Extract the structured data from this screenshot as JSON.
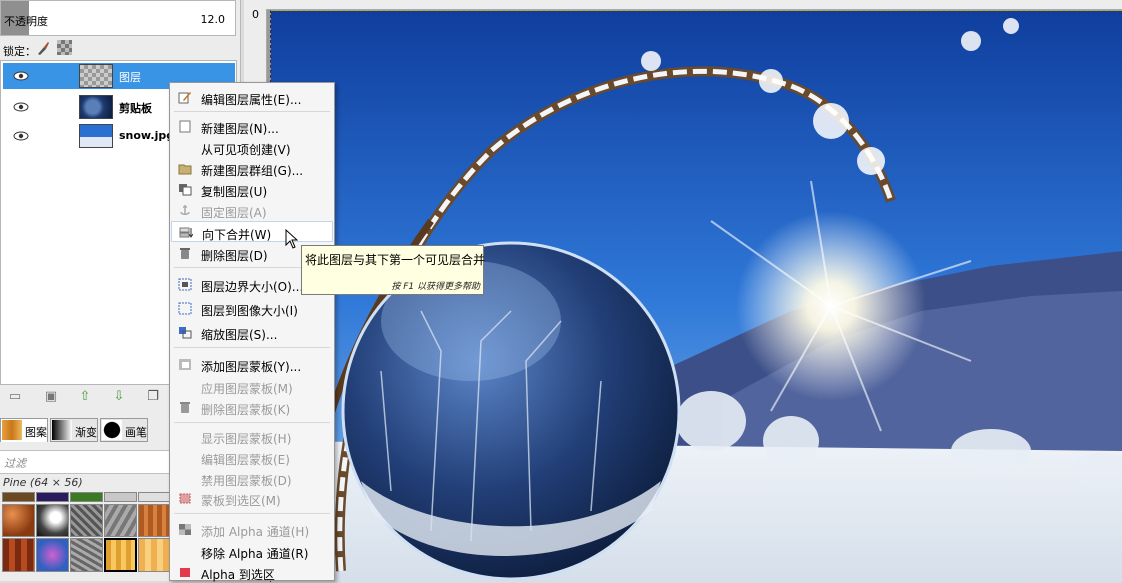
{
  "layers_panel": {
    "opacity_label": "不透明度",
    "opacity_value": "12.0",
    "lock_label": "锁定：",
    "layers": [
      {
        "name": "图层",
        "selected": true
      },
      {
        "name": "剪贴板",
        "selected": false
      },
      {
        "name": "snow.jpg",
        "selected": false
      }
    ]
  },
  "dock_tabs": [
    {
      "label": "图案",
      "active": true,
      "icon": "pattern-icon"
    },
    {
      "label": "渐变",
      "active": false,
      "icon": "gradient-icon"
    },
    {
      "label": "画笔",
      "active": false,
      "icon": "brush-icon"
    }
  ],
  "patterns_panel": {
    "filter_placeholder": "过滤",
    "selected_pattern": "Pine (64 × 56)"
  },
  "ruler": {
    "v_label": "0"
  },
  "context_menu": {
    "items": [
      {
        "label": "编辑图层属性(E)...",
        "icon": "edit-icon",
        "enabled": true
      },
      {
        "label": "新建图层(N)...",
        "icon": "new-layer-icon",
        "enabled": true
      },
      {
        "label": "从可见项创建(V)",
        "icon": "",
        "enabled": true
      },
      {
        "label": "新建图层群组(G)...",
        "icon": "folder-icon",
        "enabled": true
      },
      {
        "label": "复制图层(U)",
        "icon": "duplicate-icon",
        "enabled": true
      },
      {
        "label": "固定图层(A)",
        "icon": "anchor-icon",
        "enabled": false
      },
      {
        "label": "向下合并(W)",
        "icon": "merge-down-icon",
        "enabled": true,
        "highlighted": true
      },
      {
        "label": "删除图层(D)",
        "icon": "delete-icon",
        "enabled": true
      },
      {
        "label": "图层边界大小(O)...",
        "icon": "boundary-icon",
        "enabled": true
      },
      {
        "label": "图层到图像大小(I)",
        "icon": "layer-to-image-icon",
        "enabled": true
      },
      {
        "label": "缩放图层(S)...",
        "icon": "scale-icon",
        "enabled": true
      },
      {
        "label": "添加图层蒙板(Y)...",
        "icon": "add-mask-icon",
        "enabled": true
      },
      {
        "label": "应用图层蒙板(M)",
        "icon": "",
        "enabled": false
      },
      {
        "label": "删除图层蒙板(K)",
        "icon": "delete-mask-icon",
        "enabled": false
      },
      {
        "label": "显示图层蒙板(H)",
        "icon": "",
        "enabled": false
      },
      {
        "label": "编辑图层蒙板(E)",
        "icon": "",
        "enabled": false
      },
      {
        "label": "禁用图层蒙板(D)",
        "icon": "",
        "enabled": false
      },
      {
        "label": "蒙板到选区(M)",
        "icon": "mask-selection-icon",
        "enabled": false
      },
      {
        "label": "添加 Alpha 通道(H)",
        "icon": "alpha-icon",
        "enabled": false
      },
      {
        "label": "移除 Alpha 通道(R)",
        "icon": "",
        "enabled": true
      },
      {
        "label": "Alpha 到选区",
        "icon": "alpha-selection-icon",
        "enabled": true
      }
    ]
  },
  "tooltip": {
    "text": "将此图层与其下第一个可见层合并",
    "hint": "按 F1 以获得更多帮助"
  }
}
